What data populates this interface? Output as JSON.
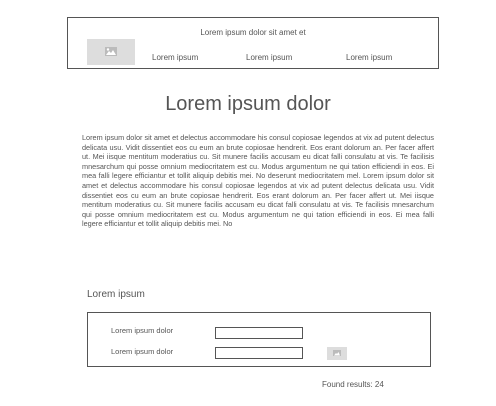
{
  "header": {
    "title": "Lorem ipsum dolor sit amet et",
    "logo_icon": "image-placeholder-icon",
    "nav": [
      "Lorem ipsum",
      "Lorem ipsum",
      "Lorem ipsum"
    ]
  },
  "main": {
    "title": "Lorem ipsum dolor",
    "paragraph": "Lorem ipsum dolor sit amet et delectus accommodare his consul copiosae legendos at vix ad putent delectus delicata usu. Vidit dissentiet eos cu eum an brute copiosae hendrerit. Eos erant dolorum an. Per facer affert ut. Mei iisque mentitum moderatius cu. Sit munere facilis accusam eu dicat falli consulatu at vis. Te facilisis mnesarchum qui posse omnium mediocritatem est cu. Modus argumentum ne qui tation efficiendi in eos. Ei mea falli legere efficiantur et tollit aliquip debitis mei. No deserunt mediocritatem mel. Lorem ipsum dolor sit amet et delectus accommodare his consul copiosae legendos at vix ad putent delectus delicata usu. Vidit dissentiet eos cu eum an brute copiosae hendrerit. Eos erant dolorum an. Per facer affert ut. Mei iisque mentitum moderatius cu. Sit munere facilis accusam eu dicat falli consulatu at vis. Te facilisis mnesarchum qui posse omnium mediocritatem est cu. Modus argumentum ne qui tation efficiendi in eos. Ei mea falli legere efficiantur et tollit aliquip debitis mei. No"
  },
  "form": {
    "section_title": "Lorem ipsum",
    "fields": [
      {
        "label": "Lorem ipsum dolor",
        "value": ""
      },
      {
        "label": "Lorem ipsum dolor",
        "value": ""
      }
    ],
    "submit_icon": "image-placeholder-icon"
  },
  "results": {
    "text": "Found results: 24"
  }
}
